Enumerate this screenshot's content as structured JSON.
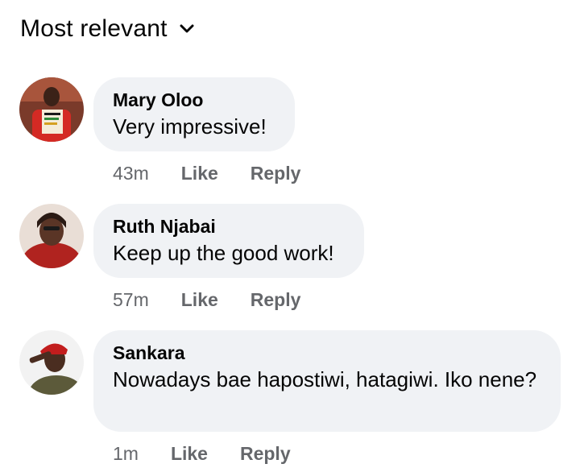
{
  "sort": {
    "label": "Most relevant",
    "icon": "chevron-down-icon"
  },
  "colors": {
    "bubble_bg": "#f0f2f5",
    "meta_text": "#65676b",
    "primary_text": "#050505"
  },
  "comments": [
    {
      "author": "Mary Oloo",
      "text": "Very impressive!",
      "time": "43m",
      "like_label": "Like",
      "reply_label": "Reply"
    },
    {
      "author": "Ruth Njabai",
      "text": "Keep up the good work!",
      "time": "57m",
      "like_label": "Like",
      "reply_label": "Reply"
    },
    {
      "author": "Sankara",
      "text": "Nowadays bae hapostiwi, hatagiwi. Iko nene?",
      "time": "1m",
      "like_label": "Like",
      "reply_label": "Reply"
    }
  ]
}
